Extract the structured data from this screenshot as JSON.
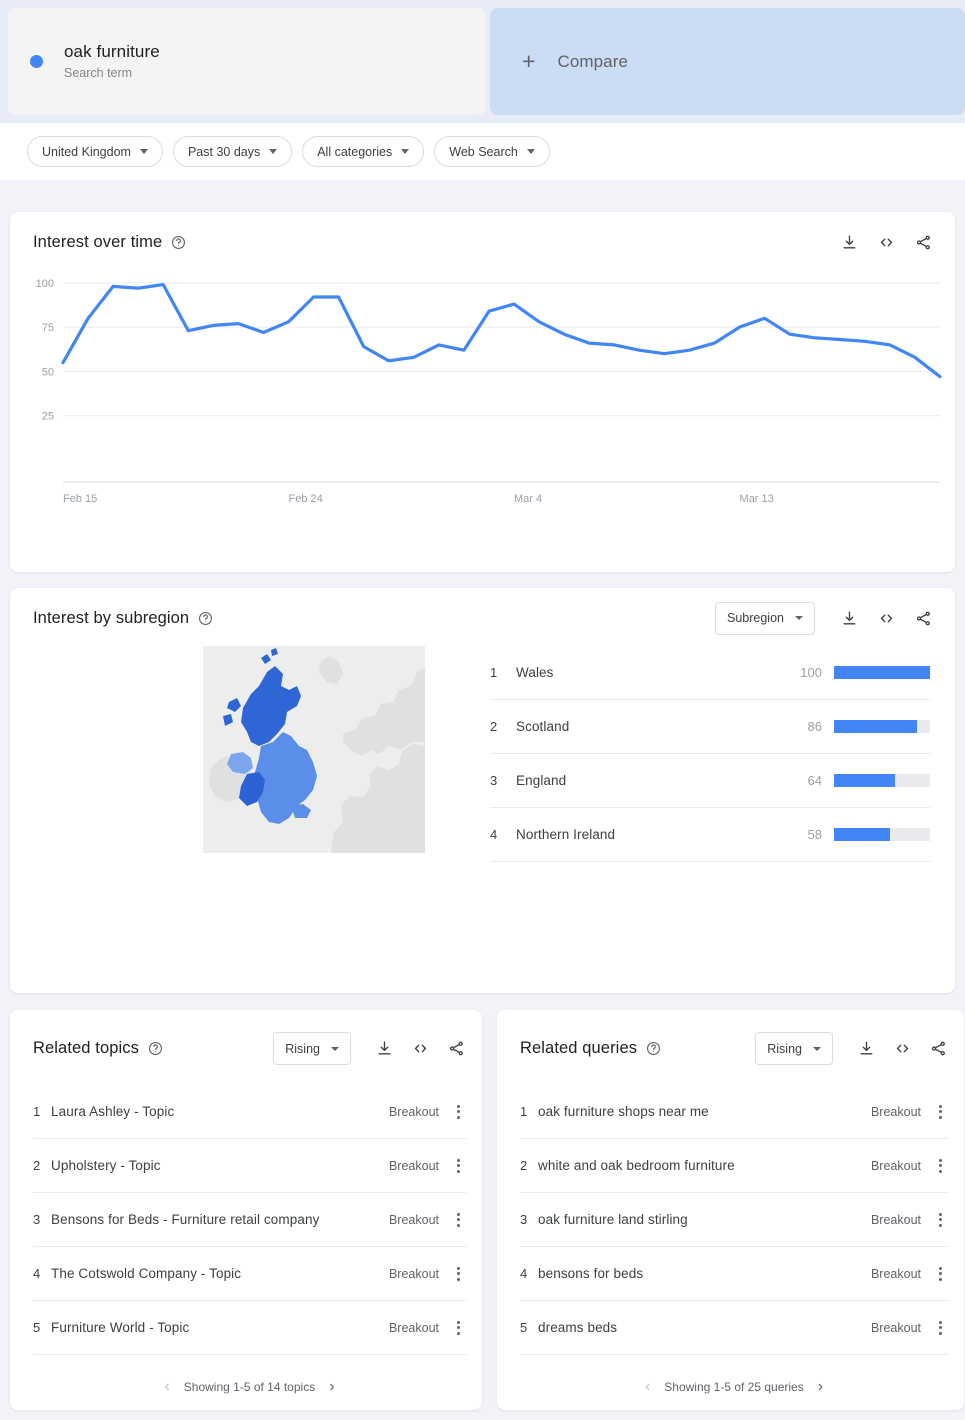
{
  "search": {
    "term": "oak furniture",
    "type_label": "Search term",
    "dot_color": "#4285f4"
  },
  "compare": {
    "label": "Compare",
    "plus_icon": "plus-icon"
  },
  "filters": [
    {
      "name": "location",
      "label": "United Kingdom"
    },
    {
      "name": "time-range",
      "label": "Past 30 days"
    },
    {
      "name": "category",
      "label": "All categories"
    },
    {
      "name": "search-type",
      "label": "Web Search"
    }
  ],
  "interest_over_time": {
    "title": "Interest over time",
    "help_icon": "help-circle-icon",
    "actions": [
      {
        "name": "download-icon",
        "label": "download"
      },
      {
        "name": "embed-code-icon",
        "label": "embed"
      },
      {
        "name": "share-icon",
        "label": "share"
      }
    ]
  },
  "interest_by_subregion": {
    "title": "Interest by subregion",
    "help_icon": "help-circle-icon",
    "breakdown_select": "Subregion",
    "actions": [
      {
        "name": "download-icon",
        "label": "download"
      },
      {
        "name": "embed-code-icon",
        "label": "embed"
      },
      {
        "name": "share-icon",
        "label": "share"
      }
    ],
    "rows": [
      {
        "rank": "1",
        "name": "Wales",
        "value": "100",
        "pct": 100
      },
      {
        "rank": "2",
        "name": "Scotland",
        "value": "86",
        "pct": 86
      },
      {
        "rank": "3",
        "name": "England",
        "value": "64",
        "pct": 64
      },
      {
        "rank": "4",
        "name": "Northern Ireland",
        "value": "58",
        "pct": 58
      }
    ]
  },
  "related_topics": {
    "title": "Related topics",
    "help_icon": "help-circle-icon",
    "sort_select": "Rising",
    "actions": [
      {
        "name": "download-icon",
        "label": "download"
      },
      {
        "name": "embed-code-icon",
        "label": "embed"
      },
      {
        "name": "share-icon",
        "label": "share"
      }
    ],
    "items": [
      {
        "rank": "1",
        "label": "Laura Ashley - Topic",
        "value": "Breakout"
      },
      {
        "rank": "2",
        "label": "Upholstery - Topic",
        "value": "Breakout"
      },
      {
        "rank": "3",
        "label": "Bensons for Beds - Furniture retail company",
        "value": "Breakout"
      },
      {
        "rank": "4",
        "label": "The Cotswold Company - Topic",
        "value": "Breakout"
      },
      {
        "rank": "5",
        "label": "Furniture World - Topic",
        "value": "Breakout"
      }
    ],
    "pager_text": "Showing 1-5 of 14 topics"
  },
  "related_queries": {
    "title": "Related queries",
    "help_icon": "help-circle-icon",
    "sort_select": "Rising",
    "actions": [
      {
        "name": "download-icon",
        "label": "download"
      },
      {
        "name": "embed-code-icon",
        "label": "embed"
      },
      {
        "name": "share-icon",
        "label": "share"
      }
    ],
    "items": [
      {
        "rank": "1",
        "label": "oak furniture shops near me",
        "value": "Breakout"
      },
      {
        "rank": "2",
        "label": "white and oak bedroom furniture",
        "value": "Breakout"
      },
      {
        "rank": "3",
        "label": "oak furniture land stirling",
        "value": "Breakout"
      },
      {
        "rank": "4",
        "label": "bensons for beds",
        "value": "Breakout"
      },
      {
        "rank": "5",
        "label": "dreams beds",
        "value": "Breakout"
      }
    ],
    "pager_text": "Showing 1-5 of 25 queries"
  },
  "chart_data": {
    "type": "line",
    "title": "Interest over time",
    "xlabel": "",
    "ylabel": "",
    "ylim": [
      0,
      105
    ],
    "yticks": [
      25,
      50,
      75,
      100
    ],
    "ytick_labels": [
      "25",
      "75",
      "100"
    ],
    "grid": true,
    "legend": false,
    "line_color": "#4285f4",
    "x_tick_labels": [
      "Feb 15",
      "Feb 24",
      "Mar 4",
      "Mar 13"
    ],
    "x_tick_indices": [
      0,
      9,
      18,
      27
    ],
    "series": [
      {
        "name": "oak furniture",
        "values": [
          55,
          80,
          98,
          97,
          99,
          73,
          76,
          77,
          72,
          78,
          92,
          92,
          64,
          56,
          58,
          65,
          62,
          84,
          88,
          78,
          71,
          66,
          65,
          62,
          60,
          62,
          66,
          75,
          80,
          71,
          69,
          68,
          67,
          65,
          58,
          47
        ]
      }
    ]
  },
  "map": {
    "name": "uk-choropleth-map",
    "sea_color": "#ededed",
    "land_color": "#e0e0e0",
    "regions": [
      {
        "name": "Wales",
        "color": "#2c62d4"
      },
      {
        "name": "Scotland",
        "color": "#2f66d6"
      },
      {
        "name": "England",
        "color": "#5b8ee8"
      },
      {
        "name": "Northern Ireland",
        "color": "#7ba6ee"
      }
    ]
  }
}
